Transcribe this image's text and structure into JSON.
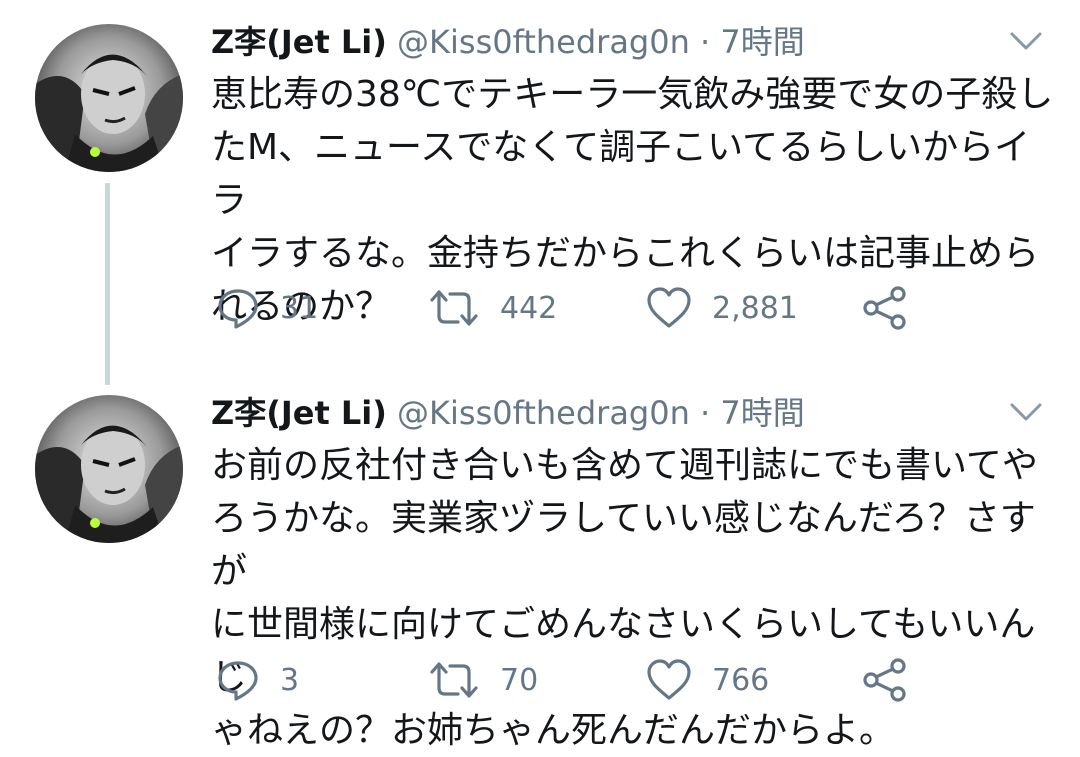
{
  "tweets": [
    {
      "display_name": "Z李(Jet Li)",
      "handle": "@Kiss0fthedrag0n",
      "separator": "·",
      "time": "7時間",
      "text": "恵比寿の38℃でテキーラ一気飲み強要で女の子殺し\nたM、ニュースでなくて調子こいてるらしいからイラ\nイラするな。金持ちだからこれくらいは記事止めら\nれるのか？",
      "replies": "31",
      "retweets": "442",
      "likes": "2,881"
    },
    {
      "display_name": "Z李(Jet Li)",
      "handle": "@Kiss0fthedrag0n",
      "separator": "·",
      "time": "7時間",
      "text": "お前の反社付き合いも含めて週刊誌にでも書いてや\nろうかな。実業家ヅラしていい感じなんだろ？さすが\nに世間様に向けてごめんなさいくらいしてもいいんじ\nゃねえの？お姉ちゃん死んだんだからよ。",
      "replies": "3",
      "retweets": "70",
      "likes": "766"
    }
  ],
  "icons": {
    "reply": "reply-icon",
    "retweet": "retweet-icon",
    "like": "heart-icon",
    "share": "share-icon",
    "caret": "chevron-down-icon"
  },
  "colors": {
    "text": "#14171a",
    "secondary": "#657786",
    "thread_line": "#ccd6dd",
    "background": "#ffffff"
  }
}
